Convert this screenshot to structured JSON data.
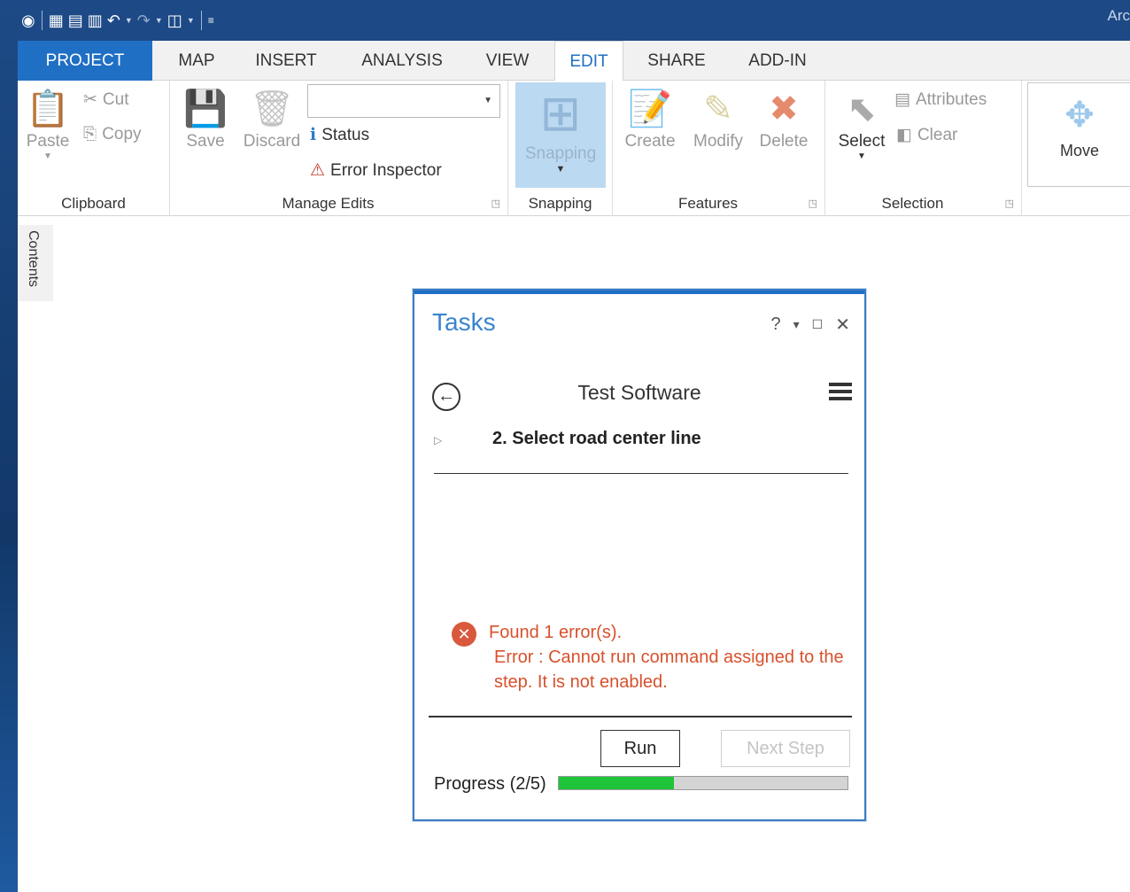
{
  "app": {
    "title_fragment": "Arc"
  },
  "tabs": [
    "PROJECT",
    "MAP",
    "INSERT",
    "ANALYSIS",
    "VIEW",
    "EDIT",
    "SHARE",
    "ADD-IN"
  ],
  "ribbon": {
    "clipboard": {
      "paste": "Paste",
      "cut": "Cut",
      "copy": "Copy",
      "label": "Clipboard"
    },
    "manage_edits": {
      "save": "Save",
      "discard": "Discard",
      "status": "Status",
      "error_inspector": "Error Inspector",
      "label": "Manage Edits",
      "combo_value": ""
    },
    "snapping": {
      "button": "Snapping",
      "label": "Snapping"
    },
    "features": {
      "create": "Create",
      "modify": "Modify",
      "delete": "Delete",
      "label": "Features"
    },
    "selection": {
      "select": "Select",
      "attributes": "Attributes",
      "clear": "Clear",
      "label": "Selection"
    },
    "move": "Move"
  },
  "side": {
    "contents": "Contents"
  },
  "tasks_pane": {
    "title": "Tasks",
    "help": "?",
    "task_name": "Test Software",
    "step": "2.  Select road center line",
    "error_line1": "Found 1 error(s).",
    "error_line2": "Error : Cannot run command assigned to the step.  It is not enabled.",
    "run": "Run",
    "next_step": "Next Step",
    "progress_label": "Progress (2/5)",
    "progress_fraction": 0.4
  },
  "colors": {
    "accent": "#1f6fc5",
    "error": "#d8512c",
    "progress": "#1ec43a"
  }
}
